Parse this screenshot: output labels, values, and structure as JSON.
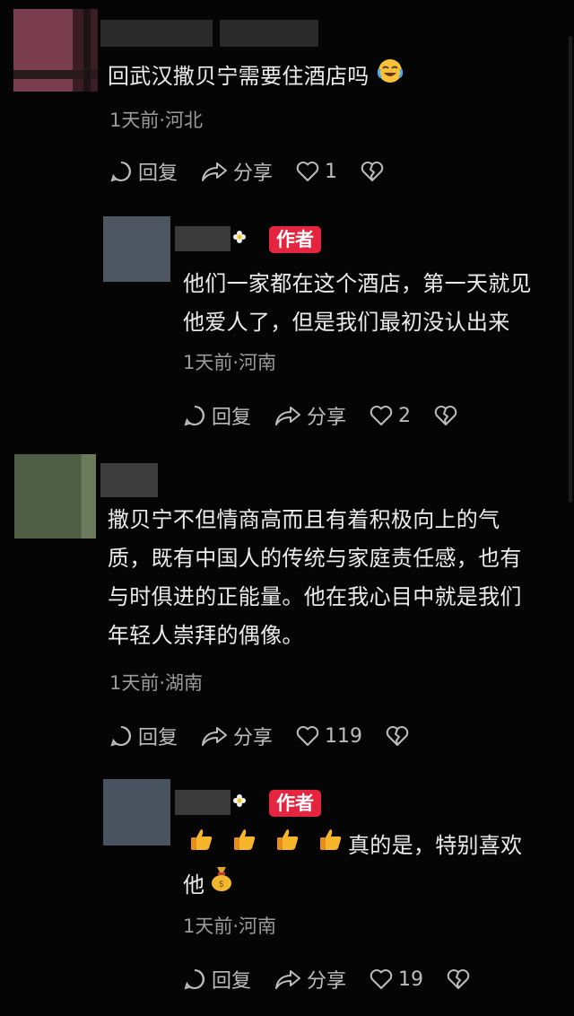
{
  "comments": [
    {
      "text": "回武汉撒贝宁需要住酒店吗",
      "emoji": "crying-laughing-emoji",
      "meta": "1天前·河北",
      "reply_label": "回复",
      "share_label": "分享",
      "likes": "1"
    },
    {
      "author_tag": "作者",
      "line1": "他们一家都在这个酒店，第一天就见",
      "line2": "他爱人了，但是我们最初没认出来",
      "meta": "1天前·河南",
      "reply_label": "回复",
      "share_label": "分享",
      "likes": "2"
    },
    {
      "line1": "撒贝宁不但情商高而且有着积极向上的气",
      "line2": "质，既有中国人的传统与家庭责任感，也有",
      "line3": "与时俱进的正能量。他在我心目中就是我们",
      "line4": "年轻人崇拜的偶像。",
      "meta": "1天前·湖南",
      "reply_label": "回复",
      "share_label": "分享",
      "likes": "119"
    },
    {
      "author_tag": "作者",
      "line1_text": "真的是，特别喜欢",
      "line2_text": "他",
      "emojis": [
        "thumbs-up-emoji",
        "thumbs-up-emoji",
        "thumbs-up-emoji",
        "thumbs-up-emoji",
        "money-bag-emoji"
      ],
      "meta": "1天前·河南",
      "reply_label": "回复",
      "share_label": "分享",
      "likes": "19"
    }
  ],
  "colors": {
    "background": "#050505",
    "author_tag": "#e5243f",
    "meta": "#9a9a9a"
  }
}
